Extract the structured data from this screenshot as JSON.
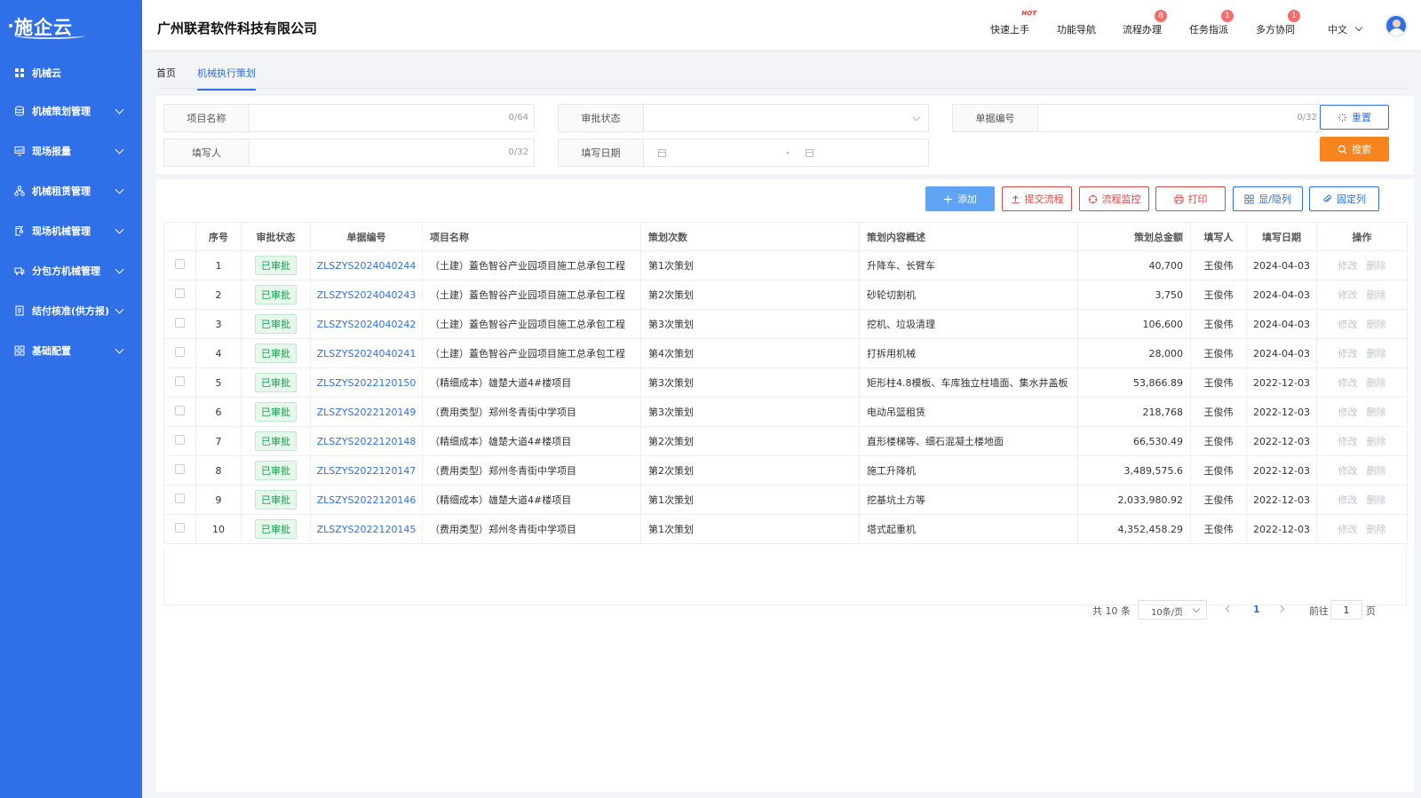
{
  "sidebar": {
    "logo": "施企云",
    "top_item": "机械云",
    "items": [
      {
        "label": "机械策划管理"
      },
      {
        "label": "现场报量"
      },
      {
        "label": "机械租赁管理"
      },
      {
        "label": "现场机械管理"
      },
      {
        "label": "分包方机械管理"
      },
      {
        "label": "结付核准(供方报)"
      },
      {
        "label": "基础配置"
      }
    ]
  },
  "header": {
    "company": "广州联君软件科技有限公司",
    "nav": [
      {
        "label": "快速上手",
        "badge": "HOT"
      },
      {
        "label": "功能导航",
        "badge": ""
      },
      {
        "label": "流程办理",
        "badge": "8"
      },
      {
        "label": "任务指派",
        "badge": "1"
      },
      {
        "label": "多方协同",
        "badge": "1"
      }
    ],
    "language": "中文"
  },
  "tabs": [
    {
      "label": "首页"
    },
    {
      "label": "机械执行策划"
    }
  ],
  "filters": {
    "project_name": {
      "label": "项目名称",
      "count": "0/64"
    },
    "approval_status": {
      "label": "审批状态"
    },
    "doc_number": {
      "label": "单据编号",
      "count": "0/32"
    },
    "filler": {
      "label": "填写人",
      "count": "0/32"
    },
    "fill_date": {
      "label": "填写日期",
      "separator": "-"
    },
    "reset_label": "重置",
    "search_label": "搜索"
  },
  "toolbar": {
    "add": "添加",
    "submit_flow": "提交流程",
    "flow_monitor": "流程监控",
    "print": "打印",
    "toggle_cols": "显/隐列",
    "fix_cols": "固定列"
  },
  "table": {
    "headers": [
      "序号",
      "审批状态",
      "单据编号",
      "项目名称",
      "策划次数",
      "策划内容概述",
      "策划总金额",
      "填写人",
      "填写日期",
      "操作"
    ],
    "edit_label": "修改",
    "delete_label": "删除",
    "rows": [
      {
        "no": "1",
        "status": "已审批",
        "doc": "ZLSZYS2024040244",
        "project": "（土建）蓋色智谷产业园项目施工总承包工程",
        "times": "第1次策划",
        "content": "升降车、长臂车",
        "amount": "40,700",
        "filler": "王俊伟",
        "date": "2024-04-03"
      },
      {
        "no": "2",
        "status": "已审批",
        "doc": "ZLSZYS2024040243",
        "project": "（土建）蓋色智谷产业园项目施工总承包工程",
        "times": "第2次策划",
        "content": "砂轮切割机",
        "amount": "3,750",
        "filler": "王俊伟",
        "date": "2024-04-03"
      },
      {
        "no": "3",
        "status": "已审批",
        "doc": "ZLSZYS2024040242",
        "project": "（土建）蓋色智谷产业园项目施工总承包工程",
        "times": "第3次策划",
        "content": "挖机、垃圾清理",
        "amount": "106,600",
        "filler": "王俊伟",
        "date": "2024-04-03"
      },
      {
        "no": "4",
        "status": "已审批",
        "doc": "ZLSZYS2024040241",
        "project": "（土建）蓋色智谷产业园项目施工总承包工程",
        "times": "第4次策划",
        "content": "打拆用机械",
        "amount": "28,000",
        "filler": "王俊伟",
        "date": "2024-04-03"
      },
      {
        "no": "5",
        "status": "已审批",
        "doc": "ZLSZYS2022120150",
        "project": "（精细成本）雄楚大道4#楼项目",
        "times": "第3次策划",
        "content": "矩形柱4.8模板、车库独立柱墙面、集水井盖板",
        "amount": "53,866.89",
        "filler": "王俊伟",
        "date": "2022-12-03"
      },
      {
        "no": "6",
        "status": "已审批",
        "doc": "ZLSZYS2022120149",
        "project": "（费用类型）郑州冬青街中学项目",
        "times": "第3次策划",
        "content": "电动吊篮租赁",
        "amount": "218,768",
        "filler": "王俊伟",
        "date": "2022-12-03"
      },
      {
        "no": "7",
        "status": "已审批",
        "doc": "ZLSZYS2022120148",
        "project": "（精细成本）雄楚大道4#楼项目",
        "times": "第2次策划",
        "content": "直形楼梯等、细石混凝土楼地面",
        "amount": "66,530.49",
        "filler": "王俊伟",
        "date": "2022-12-03"
      },
      {
        "no": "8",
        "status": "已审批",
        "doc": "ZLSZYS2022120147",
        "project": "（费用类型）郑州冬青街中学项目",
        "times": "第2次策划",
        "content": "施工升降机",
        "amount": "3,489,575.6",
        "filler": "王俊伟",
        "date": "2022-12-03"
      },
      {
        "no": "9",
        "status": "已审批",
        "doc": "ZLSZYS2022120146",
        "project": "（精细成本）雄楚大道4#楼项目",
        "times": "第1次策划",
        "content": "挖基坑土方等",
        "amount": "2,033,980.92",
        "filler": "王俊伟",
        "date": "2022-12-03"
      },
      {
        "no": "10",
        "status": "已审批",
        "doc": "ZLSZYS2022120145",
        "project": "（费用类型）郑州冬青街中学项目",
        "times": "第1次策划",
        "content": "塔式起重机",
        "amount": "4,352,458.29",
        "filler": "王俊伟",
        "date": "2022-12-03"
      }
    ]
  },
  "pagination": {
    "total": "共 10 条",
    "page_size": "10条/页",
    "current": "1",
    "goto_prefix": "前往",
    "goto_value": "1",
    "goto_suffix": "页"
  },
  "colors": {
    "primary": "#2f6fe8",
    "search": "#f7841f",
    "danger": "#e04848",
    "approved": "#1aa251"
  }
}
